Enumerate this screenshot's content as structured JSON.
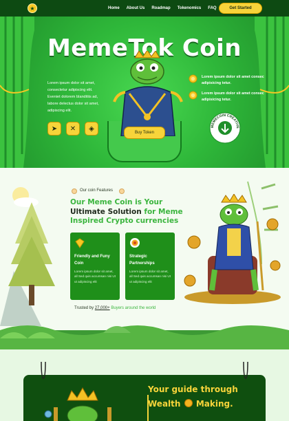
{
  "nav": {
    "links": [
      "Home",
      "About Us",
      "Roadmap",
      "Tokenomics",
      "FAQ"
    ],
    "cta_label": "Get Started"
  },
  "hero": {
    "title": "MemeTok Coin",
    "description": "Lorem ipsum dolor sit amet, consectetur adipiscing elit. Eveniet dolorem blanditiis ad, labore delectus dolor sit amet, adipiscing elit.",
    "social_icons": [
      "telegram-icon",
      "x-twitter-icon",
      "chart-icon"
    ],
    "buy_label": "Buy Token",
    "bullets": [
      "Lorem ipsum dolor sit amet consec adipisicing tetur.",
      "Lorem ipsum dolor sit amet consec adipisicing tetur."
    ],
    "badge_text": "MEMECOIN CREATIVE"
  },
  "features": {
    "label": "Our coin Features",
    "heading_part1": "Our Meme Coin is Your",
    "heading_part2": "Ultimate Solution",
    "heading_part3": "for Meme Inspired Crypto currencies",
    "cards": [
      {
        "title": "Friendly and Funy Coin",
        "text": "Lorem ipsum dolor sit amet, all Sed quis accumsan nisi Ut ut adipiscing elit"
      },
      {
        "title": "Strategic Partnerships",
        "text": "Lorem ipsum dolor sit amet, all Sed quis accumsan nisi Ut ut adipiscing elit"
      }
    ],
    "trusted_prefix": "Trusted by",
    "trusted_count": "27,000+",
    "trusted_suffix": "Buyers around the world"
  },
  "guide": {
    "line1": "Your guide through",
    "line2_a": "Wealth",
    "line2_b": "Making."
  },
  "colors": {
    "primary_green": "#2fb83a",
    "dark_green": "#0d4a12",
    "accent_yellow": "#f7d43a"
  }
}
